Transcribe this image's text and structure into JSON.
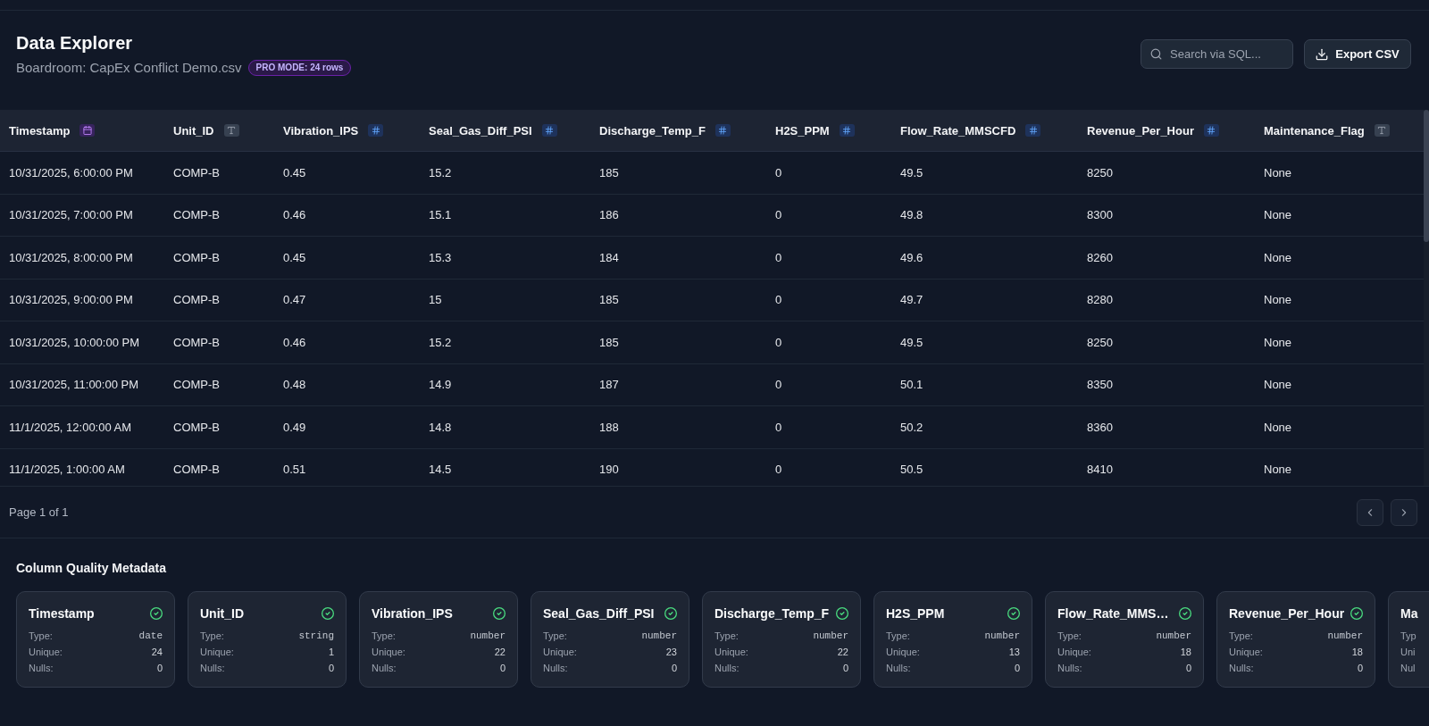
{
  "header": {
    "title": "Data Explorer",
    "subtitle": "Boardroom: CapEx Conflict Demo.csv",
    "badge": "PRO MODE: 24 rows",
    "search": {
      "placeholder": "Search via SQL..."
    },
    "export_button": "Export CSV"
  },
  "table": {
    "columns": [
      {
        "label": "Timestamp",
        "kind": "date"
      },
      {
        "label": "Unit_ID",
        "kind": "text"
      },
      {
        "label": "Vibration_IPS",
        "kind": "number"
      },
      {
        "label": "Seal_Gas_Diff_PSI",
        "kind": "number"
      },
      {
        "label": "Discharge_Temp_F",
        "kind": "number"
      },
      {
        "label": "H2S_PPM",
        "kind": "number"
      },
      {
        "label": "Flow_Rate_MMSCFD",
        "kind": "number"
      },
      {
        "label": "Revenue_Per_Hour",
        "kind": "number"
      },
      {
        "label": "Maintenance_Flag",
        "kind": "text"
      }
    ],
    "rows": [
      [
        "10/31/2025, 6:00:00 PM",
        "COMP-B",
        "0.45",
        "15.2",
        "185",
        "0",
        "49.5",
        "8250",
        "None"
      ],
      [
        "10/31/2025, 7:00:00 PM",
        "COMP-B",
        "0.46",
        "15.1",
        "186",
        "0",
        "49.8",
        "8300",
        "None"
      ],
      [
        "10/31/2025, 8:00:00 PM",
        "COMP-B",
        "0.45",
        "15.3",
        "184",
        "0",
        "49.6",
        "8260",
        "None"
      ],
      [
        "10/31/2025, 9:00:00 PM",
        "COMP-B",
        "0.47",
        "15",
        "185",
        "0",
        "49.7",
        "8280",
        "None"
      ],
      [
        "10/31/2025, 10:00:00 PM",
        "COMP-B",
        "0.46",
        "15.2",
        "185",
        "0",
        "49.5",
        "8250",
        "None"
      ],
      [
        "10/31/2025, 11:00:00 PM",
        "COMP-B",
        "0.48",
        "14.9",
        "187",
        "0",
        "50.1",
        "8350",
        "None"
      ],
      [
        "11/1/2025, 12:00:00 AM",
        "COMP-B",
        "0.49",
        "14.8",
        "188",
        "0",
        "50.2",
        "8360",
        "None"
      ],
      [
        "11/1/2025, 1:00:00 AM",
        "COMP-B",
        "0.51",
        "14.5",
        "190",
        "0",
        "50.5",
        "8410",
        "None"
      ]
    ]
  },
  "pagination": {
    "label": "Page 1 of 1"
  },
  "metadata": {
    "title": "Column Quality Metadata",
    "cards": [
      {
        "name": "Timestamp",
        "valid": true,
        "type_label": "Type:",
        "type": "date",
        "unique_label": "Unique:",
        "unique": "24",
        "nulls_label": "Nulls:",
        "nulls": "0"
      },
      {
        "name": "Unit_ID",
        "valid": true,
        "type_label": "Type:",
        "type": "string",
        "unique_label": "Unique:",
        "unique": "1",
        "nulls_label": "Nulls:",
        "nulls": "0"
      },
      {
        "name": "Vibration_IPS",
        "valid": true,
        "type_label": "Type:",
        "type": "number",
        "unique_label": "Unique:",
        "unique": "22",
        "nulls_label": "Nulls:",
        "nulls": "0"
      },
      {
        "name": "Seal_Gas_Diff_PSI",
        "valid": true,
        "type_label": "Type:",
        "type": "number",
        "unique_label": "Unique:",
        "unique": "23",
        "nulls_label": "Nulls:",
        "nulls": "0"
      },
      {
        "name": "Discharge_Temp_F",
        "valid": true,
        "type_label": "Type:",
        "type": "number",
        "unique_label": "Unique:",
        "unique": "22",
        "nulls_label": "Nulls:",
        "nulls": "0"
      },
      {
        "name": "H2S_PPM",
        "valid": true,
        "type_label": "Type:",
        "type": "number",
        "unique_label": "Unique:",
        "unique": "13",
        "nulls_label": "Nulls:",
        "nulls": "0"
      },
      {
        "name": "Flow_Rate_MMS…",
        "valid": true,
        "type_label": "Type:",
        "type": "number",
        "unique_label": "Unique:",
        "unique": "18",
        "nulls_label": "Nulls:",
        "nulls": "0"
      },
      {
        "name": "Revenue_Per_Hour",
        "valid": true,
        "type_label": "Type:",
        "type": "number",
        "unique_label": "Unique:",
        "unique": "18",
        "nulls_label": "Nulls:",
        "nulls": "0"
      },
      {
        "name": "Ma",
        "type_label": "Typ",
        "unique_label": "Uni",
        "nulls_label": "Nul"
      }
    ]
  }
}
